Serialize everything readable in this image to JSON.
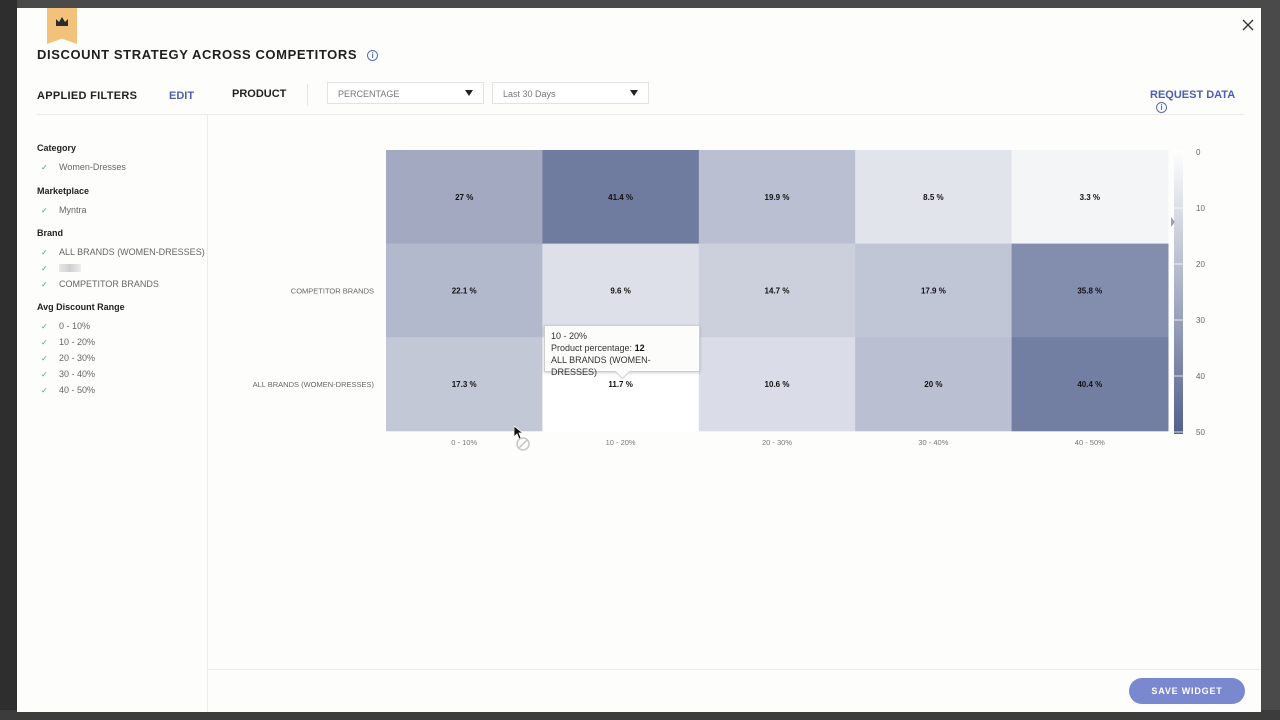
{
  "modal": {
    "title": "DISCOUNT STRATEGY ACROSS COMPETITORS",
    "info_icon": "info-circle-icon",
    "close_icon": "close-x-icon",
    "badge_icon": "crown-icon"
  },
  "filterbar": {
    "applied_filters_label": "APPLIED FILTERS",
    "edit_label": "EDIT",
    "product_label": "PRODUCT",
    "metric_select": {
      "value": "PERCENTAGE"
    },
    "period_select": {
      "value": "Last 30 Days"
    },
    "request_data_label": "REQUEST DATA"
  },
  "sidebar": {
    "groups": [
      {
        "head": "Category",
        "items": [
          "Women-Dresses"
        ]
      },
      {
        "head": "Marketplace",
        "items": [
          "Myntra"
        ]
      },
      {
        "head": "Brand",
        "items": [
          "ALL BRANDS (WOMEN-DRESSES)",
          "",
          "COMPETITOR BRANDS"
        ]
      },
      {
        "head": "Avg Discount Range",
        "items": [
          "0 - 10%",
          "10 - 20%",
          "20 - 30%",
          "30 - 40%",
          "40 - 50%"
        ]
      }
    ]
  },
  "tooltip": {
    "range": "10 - 20%",
    "metric_label": "Product percentage: ",
    "metric_value": "12",
    "series": "ALL BRANDS (WOMEN-DRESSES)"
  },
  "footer": {
    "save_label": "SAVE WIDGET"
  },
  "colors": {
    "accent": "#4c5fb0",
    "button": "#7a88cf",
    "check": "#3fa46a",
    "heat_low": "#ffffff",
    "heat_high": "#52608c"
  },
  "chart_data": {
    "type": "heatmap",
    "x_categories": [
      "0 - 10%",
      "10 - 20%",
      "20 - 30%",
      "30 - 40%",
      "40 - 50%"
    ],
    "y_categories": [
      "",
      "COMPETITOR BRANDS",
      "ALL BRANDS (WOMEN-DRESSES)"
    ],
    "values": [
      [
        27,
        41.4,
        19.9,
        8.5,
        3.3
      ],
      [
        22.1,
        9.6,
        14.7,
        17.9,
        35.8
      ],
      [
        17.3,
        11.7,
        10.6,
        20,
        40.4
      ]
    ],
    "value_suffix": " %",
    "hovered_cell": {
      "row": 2,
      "col": 1
    },
    "color_scale": {
      "min": 0,
      "max": 50,
      "ticks": [
        0,
        10,
        20,
        30,
        40,
        50
      ]
    }
  }
}
